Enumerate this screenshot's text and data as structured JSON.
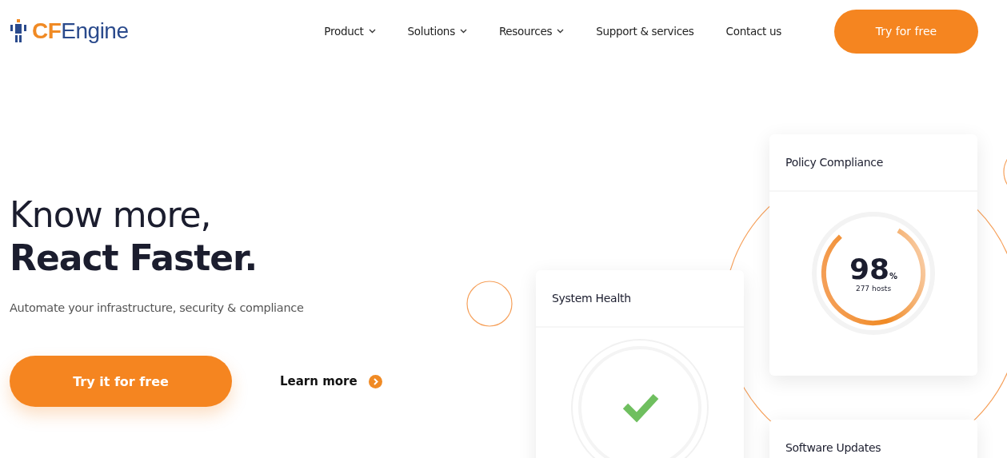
{
  "logo": {
    "accent": "CF",
    "text": "Engine"
  },
  "nav": [
    {
      "label": "Product",
      "dropdown": true
    },
    {
      "label": "Solutions",
      "dropdown": true
    },
    {
      "label": "Resources",
      "dropdown": true
    },
    {
      "label": "Support & services",
      "dropdown": false
    },
    {
      "label": "Contact us",
      "dropdown": false
    }
  ],
  "nav_button": "Try for free",
  "hero": {
    "title_line": "Know more,",
    "title_bold": "React Faster.",
    "subtitle": "Automate your infrastructure, security & compliance",
    "primary_button": "Try it for free",
    "secondary_link": "Learn more"
  },
  "cards": [
    {
      "kind": "health",
      "title": "System Health"
    },
    {
      "kind": "gauge",
      "title": "Policy Compliance",
      "value": "98",
      "unit": "%",
      "caption": "277 hosts"
    },
    {
      "kind": "plain",
      "title": "Software Updates"
    }
  ]
}
